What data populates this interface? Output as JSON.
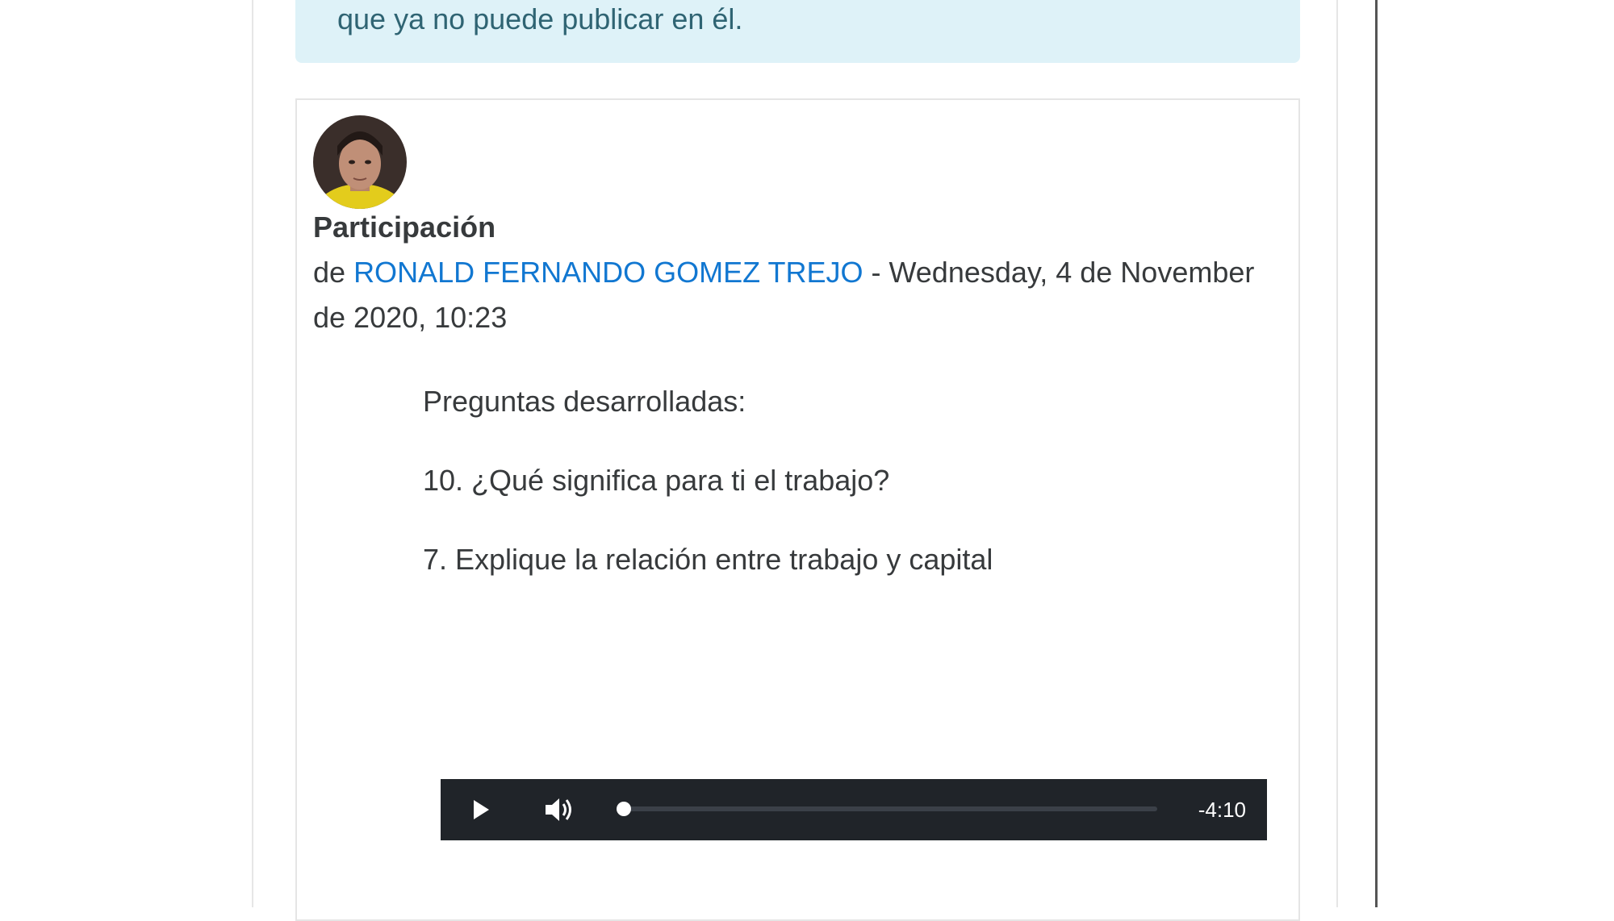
{
  "notice": {
    "text": "que ya no puede publicar en él."
  },
  "post": {
    "subject": "Participación",
    "byline_prefix": "de",
    "author": "RONALD FERNANDO GOMEZ TREJO",
    "byline_date": " - Wednesday, 4 de November de 2020, 10:23",
    "paragraphs": [
      "Preguntas desarrolladas:",
      "10. ¿Qué significa para ti el trabajo?",
      "7. Explique la relación entre trabajo y capital"
    ]
  },
  "audio_player": {
    "time_remaining": "-4:10",
    "progress_fraction": 0.0,
    "play_icon": "play-icon",
    "volume_icon": "volume-icon"
  }
}
